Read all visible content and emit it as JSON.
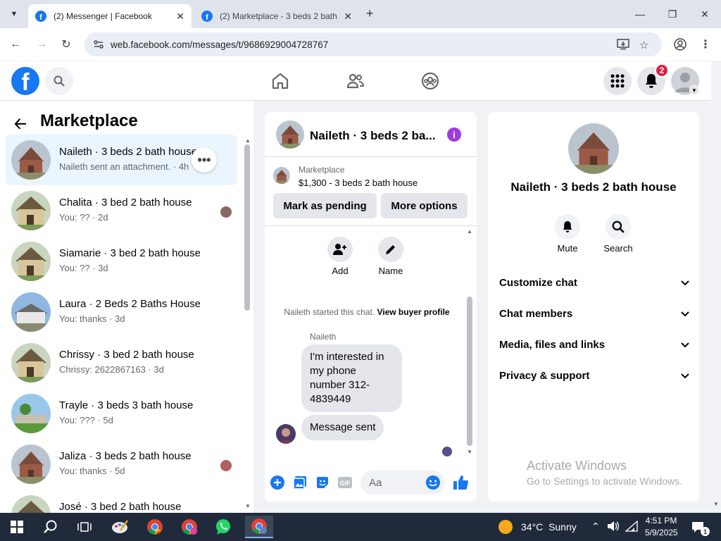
{
  "browser": {
    "tabs": [
      {
        "title": "(2) Messenger | Facebook",
        "active": true
      },
      {
        "title": "(2) Marketplace - 3 beds 2 bath",
        "active": false
      }
    ],
    "url": "web.facebook.com/messages/t/9686929004728767"
  },
  "header": {
    "notification_count": "2"
  },
  "marketplace": {
    "title": "Marketplace",
    "conversations": [
      {
        "name": "Naileth · 3 beds 2 bath house",
        "preview": "Naileth sent an attachment. · 4h",
        "selected": true
      },
      {
        "name": "Chalita · 3 bed 2 bath house",
        "preview": "You: ?? · 2d"
      },
      {
        "name": "Siamarie · 3 bed 2 bath house",
        "preview": "You: ?? · 3d"
      },
      {
        "name": "Laura · 2 Beds 2 Baths House",
        "preview": "You: thanks · 3d"
      },
      {
        "name": "Chrissy · 3 bed 2 bath house",
        "preview": "Chrissy: 2622867163 · 3d"
      },
      {
        "name": "Trayle · 3 beds 3 bath house",
        "preview": "You: ??? · 5d"
      },
      {
        "name": "Jaliza · 3 beds 2 bath house",
        "preview": "You: thanks · 5d"
      },
      {
        "name": "José · 3 bed 2 bath house",
        "preview": ""
      }
    ]
  },
  "chat": {
    "title": "Naileth · 3 beds 2 ba...",
    "listing_category": "Marketplace",
    "listing_price": "$1,300 - 3 beds 2 bath house",
    "mark_pending_label": "Mark as pending",
    "more_options_label": "More options",
    "add_label": "Add",
    "name_label": "Name",
    "started_text": "Naileth started this chat.",
    "view_profile_label": "View buyer profile",
    "sender": "Naileth",
    "messages": [
      "I'm interested in my phone number 312-4839449",
      "Message sent"
    ],
    "composer_placeholder": "Aa"
  },
  "details": {
    "name": "Naileth · 3 beds 2 bath house",
    "mute_label": "Mute",
    "search_label": "Search",
    "sections": [
      "Customize chat",
      "Chat members",
      "Media, files and links",
      "Privacy & support"
    ]
  },
  "watermark": {
    "line1": "Activate Windows",
    "line2": "Go to Settings to activate Windows."
  },
  "taskbar": {
    "temperature": "34°C",
    "weather": "Sunny",
    "time": "4:51 PM",
    "date": "5/9/2025",
    "notification_count": "1"
  },
  "colors": {
    "facebook_blue": "#1877f2",
    "selected_row": "#ebf5ff",
    "info_purple": "#a33ae0",
    "badge_red": "#e41e3f",
    "taskbar": "#202a3a"
  }
}
